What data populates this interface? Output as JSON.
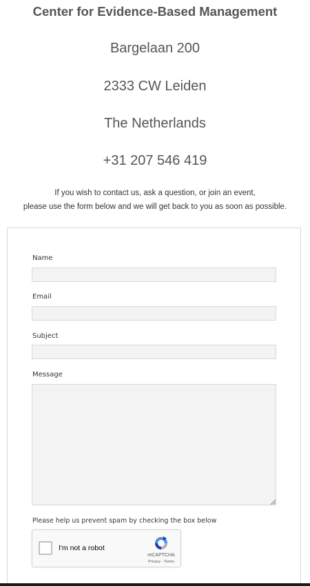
{
  "header": {
    "org_name": "Center for Evidence-Based Management",
    "address_lines": [
      "Bargelaan 200",
      "2333 CW Leiden",
      "The Netherlands",
      "+31 207 546 419"
    ]
  },
  "intro": {
    "line1": "If you wish to contact us, ask a question, or join an event,",
    "line2": "please use the form below and we will get back to you as soon as possible."
  },
  "form": {
    "fields": [
      {
        "label": "Name",
        "value": ""
      },
      {
        "label": "Email",
        "value": ""
      },
      {
        "label": "Subject",
        "value": ""
      },
      {
        "label": "Message",
        "value": ""
      }
    ],
    "spam_note": "Please help us prevent spam by checking the box below",
    "recaptcha": {
      "label": "I'm not a robot",
      "brand": "reCAPTCHA",
      "terms": "Privacy - Terms",
      "checked": false
    }
  },
  "colors": {
    "text": "#555555",
    "input_background": "#f3f3f3",
    "card_border": "#d6d6d6",
    "recaptcha_blue": "#4a90e2"
  }
}
